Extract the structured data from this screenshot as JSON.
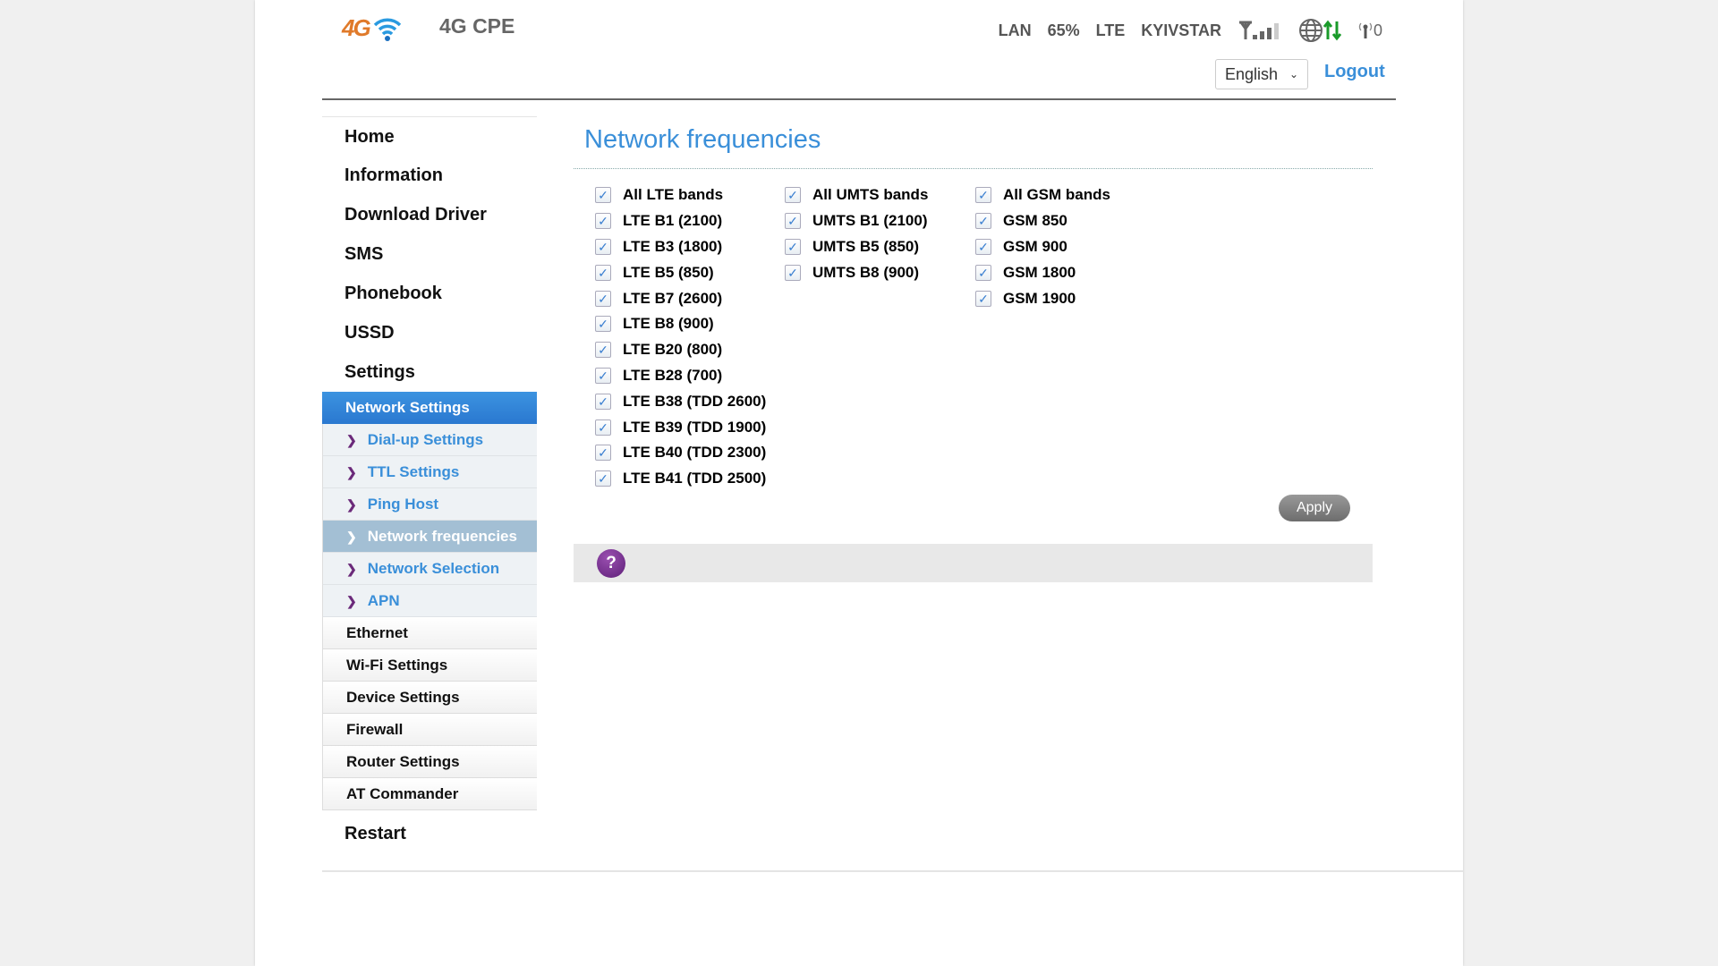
{
  "header": {
    "title": "4G CPE",
    "logo_text": "4G",
    "status": {
      "connection": "LAN",
      "battery": "65%",
      "network_type": "LTE",
      "operator": "KYIVSTAR",
      "signal_bars": 4,
      "signal_max": 5,
      "sms_count": "0"
    },
    "language": "English",
    "logout": "Logout"
  },
  "colors": {
    "accent": "#3a8fd9",
    "active_bg": "#2a78d0",
    "data_arrows": "#1a9a2a",
    "help": "#6b2a7a"
  },
  "sidebar": {
    "items": [
      "Home",
      "Information",
      "Download Driver",
      "SMS",
      "Phonebook",
      "USSD",
      "Settings"
    ],
    "settings_active": "Network Settings",
    "network_sub": [
      "Dial-up Settings",
      "TTL Settings",
      "Ping Host",
      "Network frequencies",
      "Network Selection",
      "APN"
    ],
    "active_sub": "Network frequencies",
    "sections": [
      "Ethernet",
      "Wi-Fi Settings",
      "Device Settings",
      "Firewall",
      "Router Settings",
      "AT Commander"
    ],
    "restart": "Restart"
  },
  "main": {
    "title": "Network frequencies",
    "lte": [
      {
        "label": "All LTE bands",
        "checked": true
      },
      {
        "label": "LTE B1 (2100)",
        "checked": true
      },
      {
        "label": "LTE B3 (1800)",
        "checked": true
      },
      {
        "label": "LTE B5 (850)",
        "checked": true
      },
      {
        "label": "LTE B7 (2600)",
        "checked": true
      },
      {
        "label": "LTE B8 (900)",
        "checked": true
      },
      {
        "label": "LTE B20 (800)",
        "checked": true
      },
      {
        "label": "LTE B28 (700)",
        "checked": true
      },
      {
        "label": "LTE B38 (TDD 2600)",
        "checked": true
      },
      {
        "label": "LTE B39 (TDD 1900)",
        "checked": true
      },
      {
        "label": "LTE B40 (TDD 2300)",
        "checked": true
      },
      {
        "label": "LTE B41 (TDD 2500)",
        "checked": true
      }
    ],
    "umts": [
      {
        "label": "All UMTS bands",
        "checked": true
      },
      {
        "label": "UMTS B1 (2100)",
        "checked": true
      },
      {
        "label": "UMTS B5 (850)",
        "checked": true
      },
      {
        "label": "UMTS B8 (900)",
        "checked": true
      }
    ],
    "gsm": [
      {
        "label": "All GSM bands",
        "checked": true
      },
      {
        "label": "GSM 850",
        "checked": true
      },
      {
        "label": "GSM 900",
        "checked": true
      },
      {
        "label": "GSM 1800",
        "checked": true
      },
      {
        "label": "GSM 1900",
        "checked": true
      }
    ],
    "apply": "Apply",
    "help": "?"
  }
}
